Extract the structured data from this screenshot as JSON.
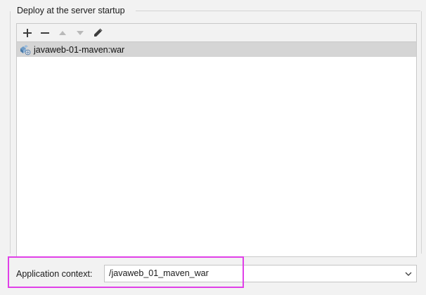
{
  "group": {
    "title": "Deploy at the server startup"
  },
  "toolbar": {
    "add_icon": "plus-icon",
    "remove_icon": "minus-icon",
    "move_up_icon": "arrow-up-icon",
    "move_down_icon": "arrow-down-icon",
    "edit_icon": "pencil-icon"
  },
  "artifacts": {
    "items": [
      {
        "label": "javaweb-01-maven:war",
        "icon": "war-artifact-icon",
        "selected": true
      }
    ]
  },
  "context": {
    "label": "Application context:",
    "value": "/javaweb_01_maven_war"
  },
  "colors": {
    "highlight": "#e040e8",
    "selection": "#d5d5d5",
    "background": "#f2f2f2"
  }
}
